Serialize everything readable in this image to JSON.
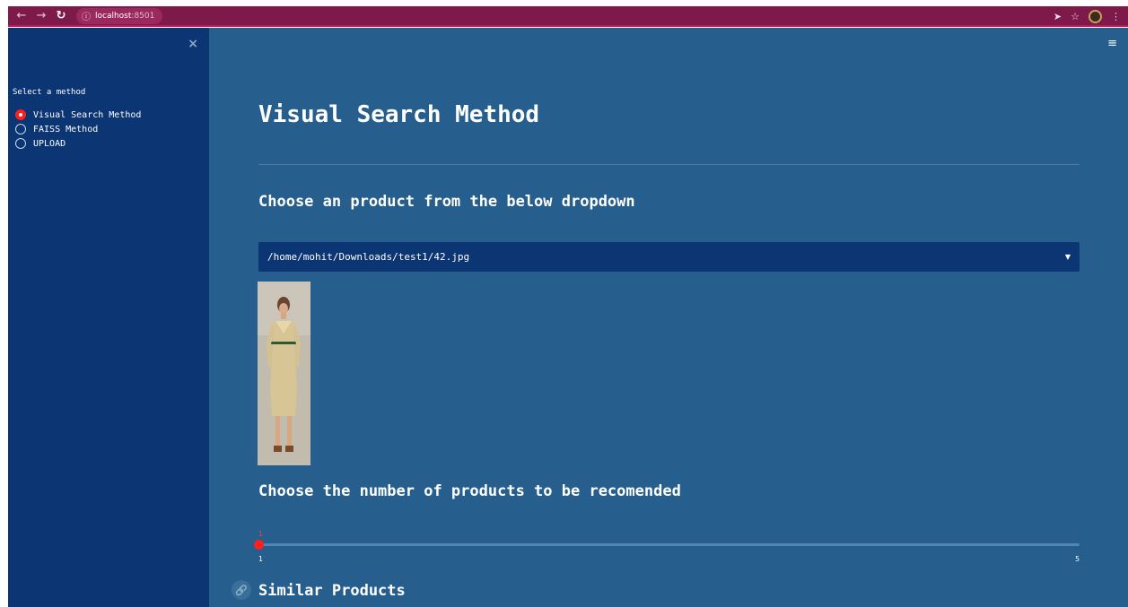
{
  "browser": {
    "url_host": "localhost",
    "url_port": ":8501",
    "icons": [
      "back-arrow-icon",
      "forward-arrow-icon",
      "reload-icon",
      "info-icon",
      "send-icon",
      "star-icon",
      "profile-icon",
      "kebab-menu-icon"
    ]
  },
  "sidebar": {
    "close_icon": "×",
    "radio_title": "Select a method",
    "options": [
      {
        "label": "Visual Search Method",
        "checked": true
      },
      {
        "label": "FAISS Method",
        "checked": false
      },
      {
        "label": "UPLOAD",
        "checked": false
      }
    ]
  },
  "main": {
    "menu_icon": "≡",
    "title": "Visual Search Method",
    "subheader_choose_product": "Choose an product from the below dropdown",
    "select_value": "/home/mohit/Downloads/test1/42.jpg",
    "image_content": "woman in beige shirt dress",
    "subheader_choose_number": "Choose the number of products to be recomended",
    "slider": {
      "value": "1",
      "min": "1",
      "max": "5",
      "fraction": 0
    },
    "subheader_similar": "Similar Products"
  },
  "colors": {
    "browser_bar": "#7d1a4a",
    "sidebar_bg": "#0b3573",
    "main_bg": "#265e8d",
    "accent": "#ff1f1f",
    "text": "#ffffff"
  }
}
